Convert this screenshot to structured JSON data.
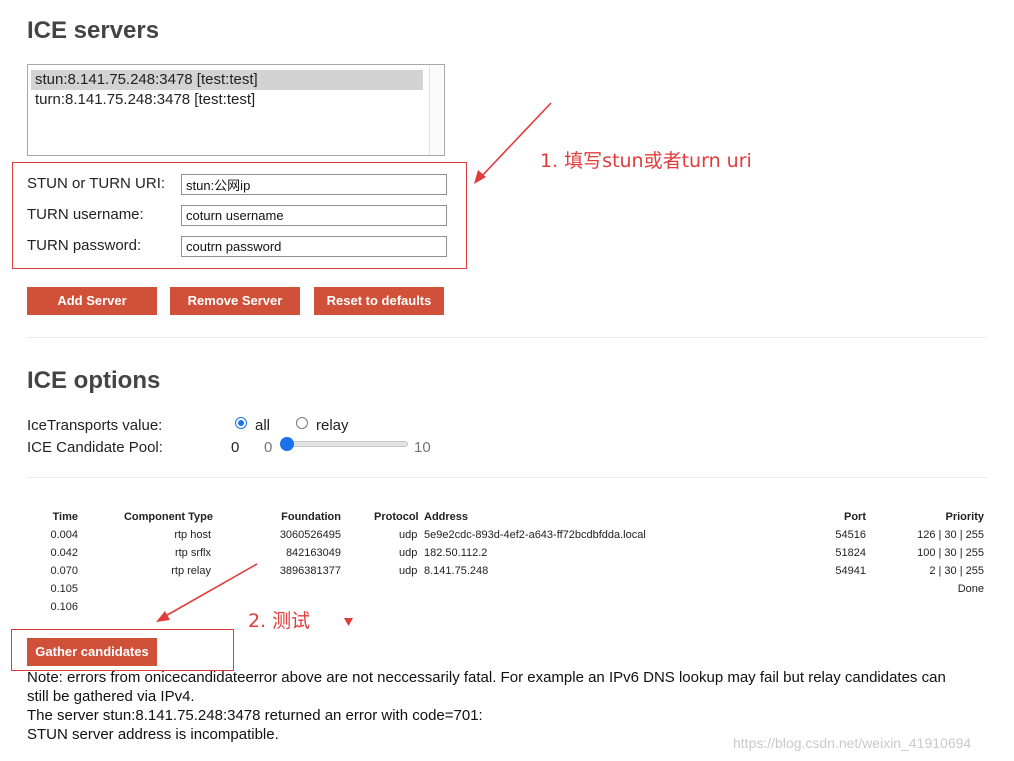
{
  "ice_servers": {
    "heading": "ICE servers",
    "list": [
      "stun:8.141.75.248:3478 [test:test]",
      "turn:8.141.75.248:3478 [test:test]"
    ],
    "uri_label": "STUN or TURN URI:",
    "uri_value": "stun:公网ip",
    "username_label": "TURN username:",
    "username_value": "coturn username",
    "password_label": "TURN password:",
    "password_value": "coutrn password",
    "add_button": "Add Server",
    "remove_button": "Remove Server",
    "reset_button": "Reset to defaults"
  },
  "ice_options": {
    "heading": "ICE options",
    "transports_label": "IceTransports value:",
    "transport_all": "all",
    "transport_relay": "relay",
    "transport_selected": "all",
    "pool_label": "ICE Candidate Pool:",
    "pool_value": "0",
    "pool_min": "0",
    "pool_max": "10"
  },
  "candidates": {
    "headers": [
      "Time",
      "Component Type",
      "Foundation",
      "Protocol",
      "Address",
      "Port",
      "Priority"
    ],
    "rows": [
      {
        "time": "0.004",
        "type": "rtp host",
        "foundation": "3060526495",
        "protocol": "udp",
        "address": "5e9e2cdc-893d-4ef2-a643-ff72bcdbfdda.local",
        "port": "54516",
        "priority": "126 | 30 | 255"
      },
      {
        "time": "0.042",
        "type": "rtp srflx",
        "foundation": "842163049",
        "protocol": "udp",
        "address": "182.50.112.2",
        "port": "51824",
        "priority": "100 | 30 | 255"
      },
      {
        "time": "0.070",
        "type": "rtp relay",
        "foundation": "3896381377",
        "protocol": "udp",
        "address": "8.141.75.248",
        "port": "54941",
        "priority": "2 | 30 | 255"
      },
      {
        "time": "0.105",
        "type": "",
        "foundation": "",
        "protocol": "",
        "address": "",
        "port": "",
        "priority": "Done"
      },
      {
        "time": "0.106",
        "type": "",
        "foundation": "",
        "protocol": "",
        "address": "",
        "port": "",
        "priority": ""
      }
    ],
    "gather_button": "Gather candidates"
  },
  "notes": {
    "line1": "Note: errors from onicecandidateerror above are not neccessarily fatal. For example an IPv6 DNS lookup may fail but relay candidates can",
    "line2": "still be gathered via IPv4.",
    "line3": "The server stun:8.141.75.248:3478 returned an error with code=701:",
    "line4": "STUN server address is incompatible."
  },
  "annotations": {
    "step1": "1. 填写stun或者turn uri",
    "step2": "2. 测试"
  },
  "watermark": "https://blog.csdn.net/weixin_41910694",
  "colors": {
    "button": "#d1503a",
    "annotation": "#e23b3b",
    "radio_accent": "#1a73e8"
  }
}
